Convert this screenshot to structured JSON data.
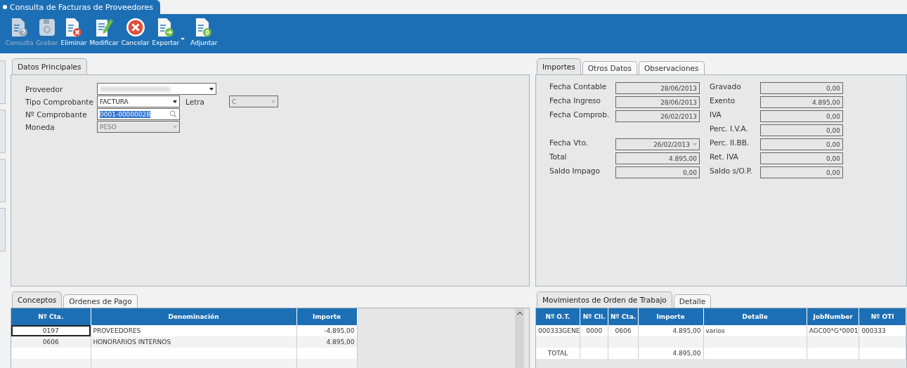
{
  "window_tab": {
    "title": "Consulta de Facturas de Proveedores"
  },
  "toolbar": [
    {
      "label": "Consulta",
      "kind": "query",
      "disabled": true,
      "has_menu": false
    },
    {
      "label": "Grabar",
      "kind": "save",
      "disabled": true,
      "has_menu": false
    },
    {
      "label": "Eliminar",
      "kind": "delete",
      "disabled": false,
      "has_menu": false
    },
    {
      "label": "Modificar",
      "kind": "edit",
      "disabled": false,
      "has_menu": false
    },
    {
      "label": "Cancelar",
      "kind": "cancel",
      "disabled": false,
      "has_menu": false
    },
    {
      "label": "Exportar",
      "kind": "export",
      "disabled": false,
      "has_menu": true
    },
    {
      "label": "Adjuntar",
      "kind": "attach",
      "disabled": false,
      "has_menu": false
    }
  ],
  "main_panel": {
    "tabs": [
      {
        "label": "Datos Principales",
        "selected": true
      }
    ],
    "proveedor": {
      "label": "Proveedor"
    },
    "tipo": {
      "label": "Tipo Comprobante",
      "value": "FACTURA"
    },
    "letra": {
      "label": "Letra",
      "value": "C",
      "disabled": true
    },
    "numero": {
      "label": "Nº Comprobante",
      "value": "0001-00000028"
    },
    "moneda": {
      "label": "Moneda",
      "value": "PESO",
      "disabled": true
    }
  },
  "amounts_panel": {
    "tabs": [
      {
        "label": "Importes",
        "selected": true
      },
      {
        "label": "Otros Datos",
        "selected": false
      },
      {
        "label": "Observaciones",
        "selected": false
      }
    ],
    "dates": [
      {
        "label": "Fecha Contable",
        "value": "28/06/2013"
      },
      {
        "label": "Fecha Ingreso",
        "value": "28/06/2013"
      },
      {
        "label": "Fecha Comprob.",
        "value": "26/02/2013"
      }
    ],
    "balances": [
      {
        "label": "Fecha Vto.",
        "value": "26/02/2013",
        "kind": "combo"
      },
      {
        "label": "Total",
        "value": "4.895,00",
        "kind": "text"
      },
      {
        "label": "Saldo Impago",
        "value": "0,00",
        "kind": "text"
      }
    ],
    "taxes": [
      {
        "label": "Gravado",
        "value": "0,00"
      },
      {
        "label": "Exento",
        "value": "4.895,00"
      },
      {
        "label": "IVA",
        "value": "0,00"
      },
      {
        "label": "Perc. I.V.A.",
        "value": "0,00"
      },
      {
        "label": "Perc. II.BB.",
        "value": "0,00"
      },
      {
        "label": "Ret. IVA",
        "value": "0,00"
      },
      {
        "label": "Saldo s/O.P.",
        "value": "0,00"
      }
    ]
  },
  "concepts": {
    "tabs": [
      {
        "label": "Conceptos",
        "selected": true
      },
      {
        "label": "Ordenes de Pago",
        "selected": false
      }
    ],
    "columns": [
      "Nº Cta.",
      "Denominación",
      "Importe"
    ],
    "rows": [
      {
        "cells": [
          "0197",
          "PROVEEDORES",
          "-4.895,00"
        ],
        "focused": true
      },
      {
        "cells": [
          "0606",
          "HONORARIOS INTERNOS",
          "4.895,00"
        ],
        "focused": false
      }
    ]
  },
  "work_orders": {
    "tabs": [
      {
        "label": "Movimientos de Orden de Trabajo",
        "selected": true
      },
      {
        "label": "Detalle",
        "selected": false
      }
    ],
    "columns": [
      "Nº O.T.",
      "Nº Cli.",
      "Nº Cta.",
      "Importe",
      "Detalle",
      "JobNumber",
      "Nº OTI"
    ],
    "rows": [
      [
        "000333GENE",
        "0000",
        "0606",
        "4.895,00",
        "varios",
        "AGC00*G*0001",
        "000333"
      ]
    ],
    "total": {
      "label": "TOTAL",
      "importe": "4.895,00"
    }
  }
}
